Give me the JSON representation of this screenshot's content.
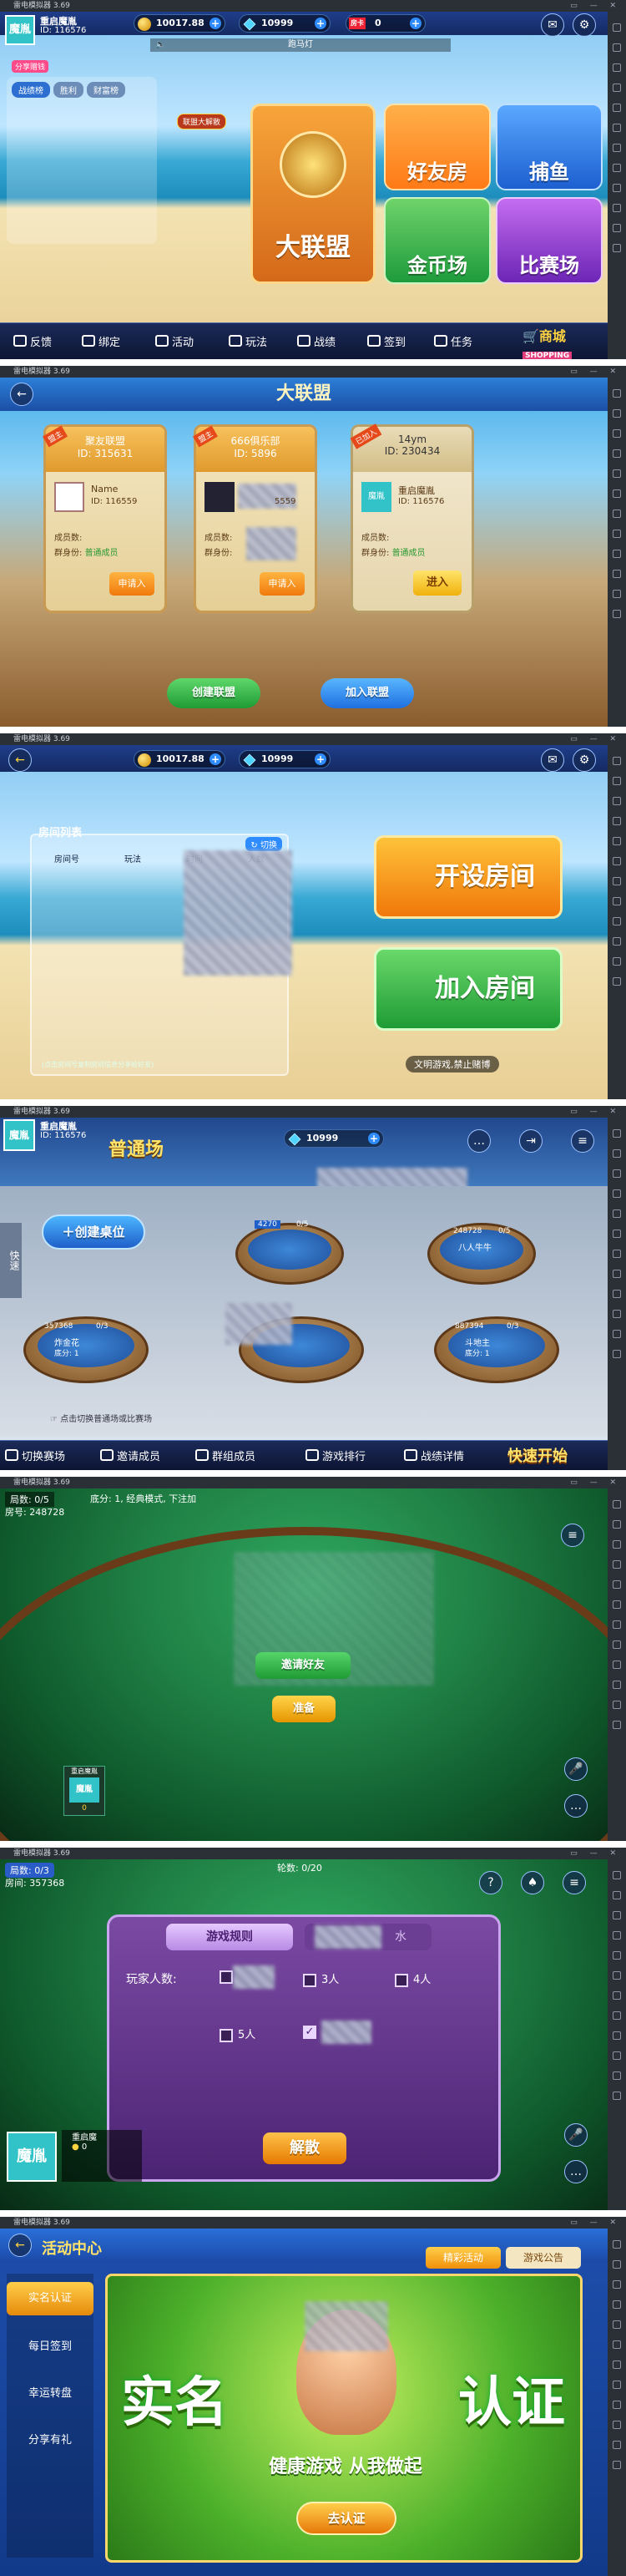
{
  "emulator": {
    "title": "雷电模拟器 3.69"
  },
  "p1": {
    "logo": "魔胤",
    "player": {
      "name": "重启魔胤",
      "id": "ID: 116576"
    },
    "coins": "10017.88",
    "gems": "10999",
    "room_cards": "0",
    "room_card_badge": "房卡",
    "marquee": "跑马灯",
    "mode_badge": "分享赠钱",
    "tabs": [
      "战绩榜",
      "胜利",
      "财富榜"
    ],
    "union_label": "大联盟",
    "badge_label": "联盟大解散",
    "tiles": [
      {
        "label": "好友房",
        "color": "#ff8a1f"
      },
      {
        "label": "捕鱼",
        "color": "#2f7ee8"
      },
      {
        "label": "金币场",
        "color": "#33b24a"
      },
      {
        "label": "比赛场",
        "color": "#9a3fd6"
      }
    ],
    "bottom": [
      "反馈",
      "绑定",
      "活动",
      "玩法",
      "战绩",
      "签到",
      "任务"
    ],
    "shop": {
      "label": "商城",
      "sub": "SHOPPING"
    }
  },
  "p2": {
    "title": "大联盟",
    "cards": [
      {
        "tag": "盟主",
        "name": "聚友联盟",
        "id": "ID: 315631",
        "owner": "Name",
        "owner_id": "ID: 116559",
        "members_label": "成员数:",
        "role_label": "群身份:",
        "role": "普通成员",
        "action": "申请入"
      },
      {
        "tag": "盟主",
        "name": "666俱乐部",
        "id": "ID: 5896",
        "owner": "",
        "owner_id": "5559",
        "members_label": "成员数:",
        "role_label": "群身份:",
        "role": "",
        "action": "申请入"
      },
      {
        "tag": "已加入",
        "name": "14ym",
        "id": "ID: 230434",
        "owner": "重启魔胤",
        "owner_id": "ID: 116576",
        "members_label": "成员数:",
        "role_label": "群身份:",
        "role": "普通成员",
        "action": "进入"
      }
    ],
    "create": "创建联盟",
    "join": "加入联盟"
  },
  "p3": {
    "coins": "10017.88",
    "gems": "10999",
    "room_list": {
      "title": "房间列表",
      "switch": "切换",
      "cols": [
        "房间号",
        "玩法",
        "时间",
        "人数"
      ],
      "hint": "(点击房间号复制房间信息分享给好友)"
    },
    "create": "开设房间",
    "join": "加入房间",
    "notice": "文明游戏,禁止赌博"
  },
  "p4": {
    "logo": "魔胤",
    "player": {
      "name": "重启魔胤",
      "id": "ID: 116576"
    },
    "title": "普通场",
    "gems": "10999",
    "create_table": "创建桌位",
    "tables": [
      {
        "id": "4270",
        "count": "0/5"
      },
      {
        "id": "248728",
        "count": "0/5",
        "game": "八人牛牛"
      },
      {
        "id": "357368",
        "count": "0/3",
        "game": "炸金花",
        "base": "底分: 1"
      },
      {
        "id": "",
        "count": ""
      },
      {
        "id": "887394",
        "count": "0/3",
        "game": "斗地主",
        "base": "底分: 1"
      }
    ],
    "side": "快速",
    "hint": "点击切换普通场或比赛场",
    "bottom": [
      "切换赛场",
      "邀请成员",
      "群组成员",
      "游戏排行",
      "战绩详情"
    ],
    "quick": "快速开始"
  },
  "p5": {
    "rounds": "局数: 0/5",
    "desc": "底分: 1, 经典模式, 下注加",
    "room": "房号: 248728",
    "invite": "邀请好友",
    "ready": "准备",
    "seat": {
      "logo": "魔胤",
      "name": "重启魔胤",
      "score": "0"
    }
  },
  "p6": {
    "rounds": "局数: 0/3",
    "room": "房间: 357368",
    "turn": "轮数: 0/20",
    "tabs": [
      "游戏规则",
      "水"
    ],
    "players_label": "玩家人数:",
    "options": [
      "3人",
      "4人",
      "5人"
    ],
    "dismiss": "解散",
    "seat": {
      "logo": "魔胤",
      "name": "重启魔",
      "score": "0"
    }
  },
  "p7": {
    "title": "活动中心",
    "tabs": [
      "精彩活动",
      "游戏公告"
    ],
    "menu": [
      "实名认证",
      "每日签到",
      "幸运转盘",
      "分享有礼"
    ],
    "banner": {
      "left": "实名",
      "right": "认证",
      "slogan": "健康游戏 从我做起",
      "btn": "去认证"
    }
  },
  "colors": {
    "gold": "#ffd23f",
    "green_btn": "#35b24a",
    "blue_btn": "#2f8cff",
    "felt": "#1f7f44",
    "purple": "#5a2d82"
  }
}
